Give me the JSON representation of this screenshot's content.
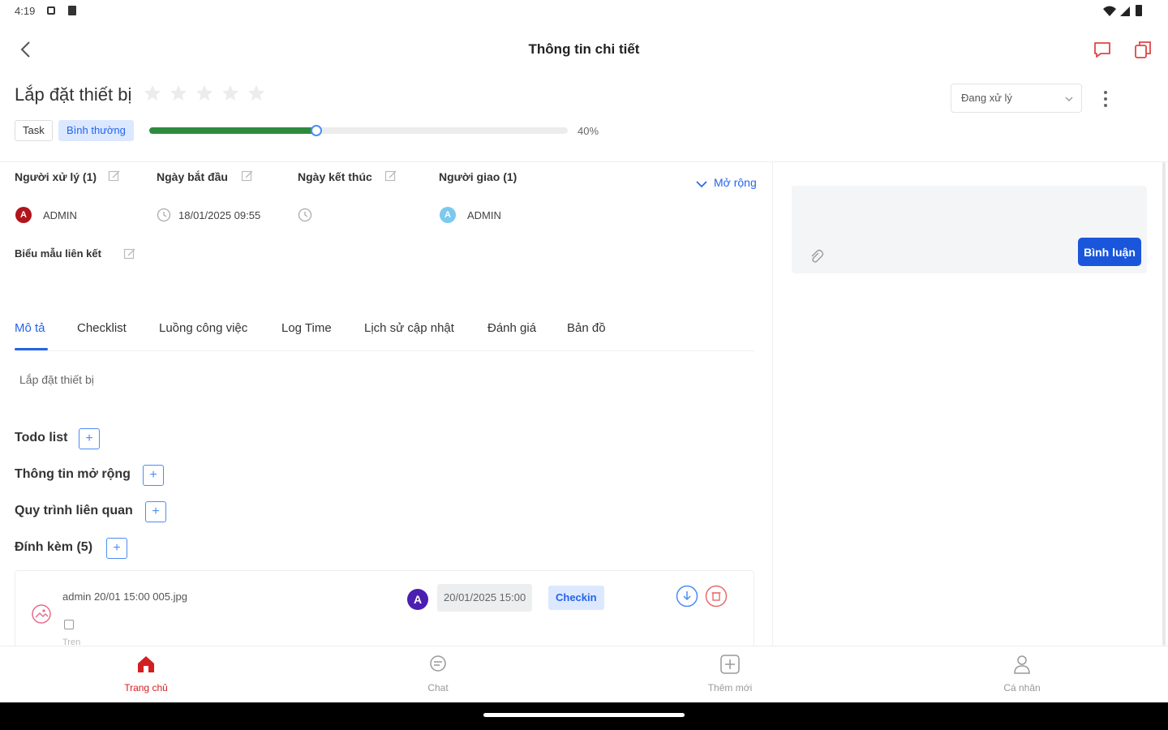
{
  "status_bar": {
    "time": "4:19"
  },
  "header": {
    "title": "Thông tin chi tiết"
  },
  "task": {
    "title": "Lắp đặt thiết bị",
    "rating": 0,
    "rating_max": 5,
    "type_badge": "Task",
    "priority_badge": "Bình thường",
    "progress": 40,
    "progress_label": "40%",
    "status_value": "Đang xử lý"
  },
  "info": {
    "assignee_label": "Người xử lý (1)",
    "assignee_name": "ADMIN",
    "assignee_initial": "A",
    "start_label": "Ngày bắt đầu",
    "start_value": "18/01/2025 09:55",
    "end_label": "Ngày kết thúc",
    "assigner_label": "Người giao (1)",
    "assigner_name": "ADMIN",
    "assigner_initial": "A",
    "form_label": "Biểu mẫu liên kết",
    "expand_label": "Mở rộng"
  },
  "comment": {
    "button_label": "Bình luận"
  },
  "tabs": [
    {
      "label": "Mô tả",
      "active": true
    },
    {
      "label": "Checklist"
    },
    {
      "label": "Luồng công việc"
    },
    {
      "label": "Log Time"
    },
    {
      "label": "Lịch sử cập nhật"
    },
    {
      "label": "Đánh giá"
    },
    {
      "label": "Bản đồ"
    }
  ],
  "description": "Lắp đặt thiết bị",
  "sections": {
    "todo": "Todo list",
    "extended": "Thông tin mở rộng",
    "process": "Quy trình liên quan",
    "attachments": "Đính kèm (5)"
  },
  "attachment": {
    "filename": "admin 20/01 15:00 005.jpg",
    "avatar_initial": "A",
    "date": "20/01/2025 15:00",
    "tag": "Checkin",
    "extra": "Tren"
  },
  "bottom_nav": [
    {
      "label": "Trang chủ",
      "icon": "home-icon",
      "active": true
    },
    {
      "label": "Chat",
      "icon": "chat-icon"
    },
    {
      "label": "Thêm mới",
      "icon": "add-icon"
    },
    {
      "label": "Cá nhân",
      "icon": "person-icon"
    }
  ],
  "colors": {
    "accent": "#2563eb",
    "progress": "#2e8b3e",
    "nav_active": "#d21f1f",
    "avatar_red": "#b0151b",
    "avatar_purple": "#4b1fb0"
  }
}
